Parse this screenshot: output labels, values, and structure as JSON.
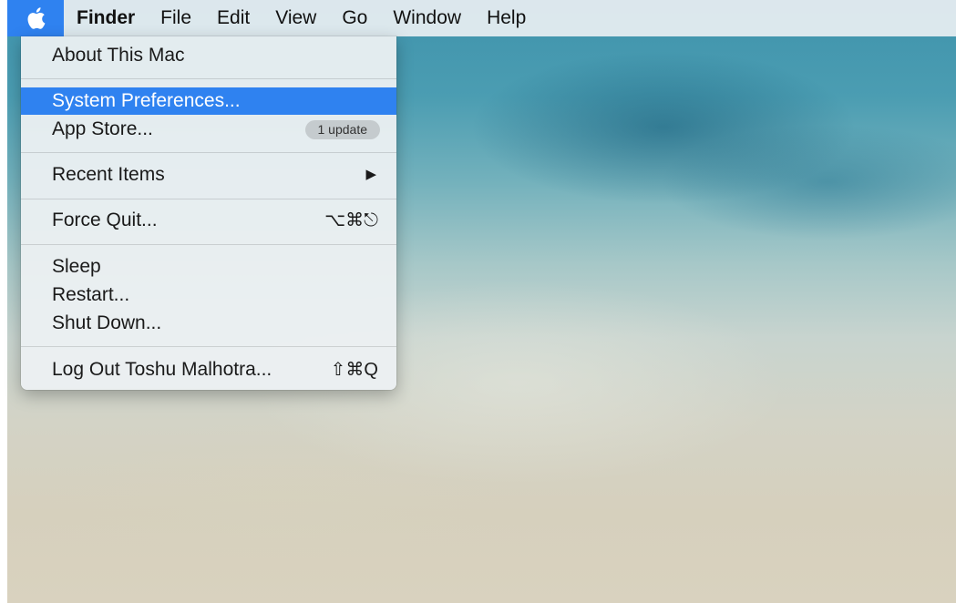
{
  "menubar": {
    "apple_icon": "apple-logo",
    "items": [
      "Finder",
      "File",
      "Edit",
      "View",
      "Go",
      "Window",
      "Help"
    ]
  },
  "apple_menu": {
    "about": "About This Mac",
    "system_preferences": "System Preferences...",
    "app_store": "App Store...",
    "app_store_badge": "1 update",
    "recent_items": "Recent Items",
    "recent_items_icon": "submenu-arrow",
    "force_quit": "Force Quit...",
    "force_quit_shortcut": "⌥⌘⎋",
    "sleep": "Sleep",
    "restart": "Restart...",
    "shut_down": "Shut Down...",
    "log_out": "Log Out Toshu Malhotra...",
    "log_out_shortcut": "⇧⌘Q"
  },
  "colors": {
    "highlight": "#2f82f0",
    "menu_background": "#eef1f3"
  }
}
